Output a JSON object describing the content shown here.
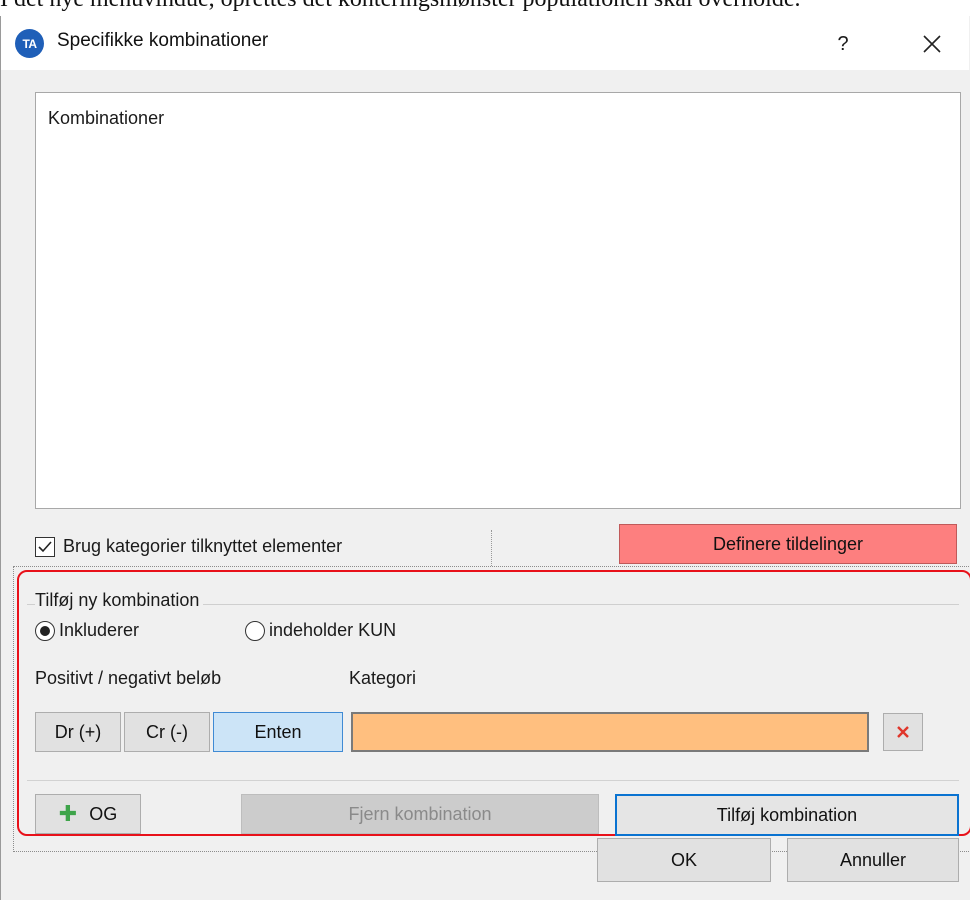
{
  "caption": "I det nye menuvindue, oprettes det konteringsmønster populationen skal overholde.",
  "window": {
    "icon_text": "TA",
    "title": "Specifikke kombinationer",
    "help_glyph": "?",
    "close_glyph": "✕"
  },
  "list": {
    "header": "Kombinationer"
  },
  "use_categories": {
    "label": "Brug kategorier tilknyttet elementer",
    "checked": true
  },
  "define_button": {
    "label": "Definere tildelinger",
    "color": "#fd7f7f"
  },
  "new_combination": {
    "group_label": "Tilføj ny kombination",
    "radio_include": {
      "label": "Inkluderer",
      "selected": true
    },
    "radio_only": {
      "label": "indeholder KUN",
      "selected": false
    },
    "amount_label": "Positivt / negativt beløb",
    "amount_buttons": [
      {
        "label": "Dr (+)",
        "selected": false
      },
      {
        "label": "Cr (-)",
        "selected": false
      },
      {
        "label": "Enten",
        "selected": true
      }
    ],
    "category_label": "Kategori",
    "category_value": "",
    "category_color": "#ffbf7f",
    "and_button": "OG",
    "remove_button": "Fjern kombination",
    "add_button": "Tilføj kombination"
  },
  "footer": {
    "ok": "OK",
    "cancel": "Annuller"
  },
  "highlight_color": "#e8111a"
}
